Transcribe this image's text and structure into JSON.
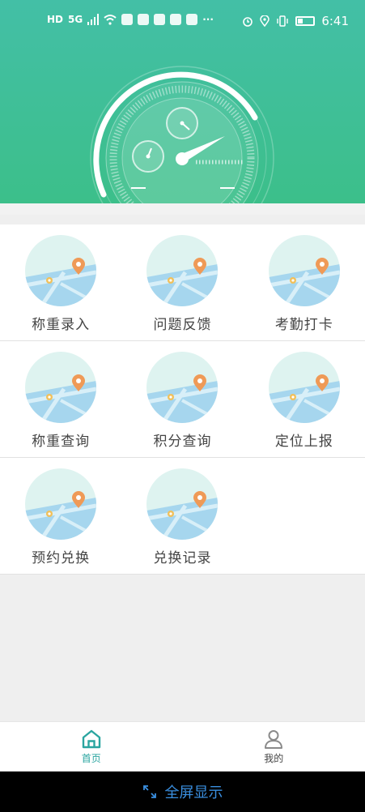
{
  "status_bar": {
    "left_text": [
      "HD",
      "5G"
    ],
    "more": "···",
    "time": "6:41"
  },
  "menu": {
    "rows": [
      [
        {
          "label": "称重录入"
        },
        {
          "label": "问题反馈"
        },
        {
          "label": "考勤打卡"
        }
      ],
      [
        {
          "label": "称重查询"
        },
        {
          "label": "积分查询"
        },
        {
          "label": "定位上报"
        }
      ],
      [
        {
          "label": "预约兑换"
        },
        {
          "label": "兑换记录"
        }
      ]
    ]
  },
  "tabs": [
    {
      "label": "首页",
      "icon": "home-icon",
      "active": true
    },
    {
      "label": "我的",
      "icon": "user-icon",
      "active": false
    }
  ],
  "fullscreen": {
    "label": "全屏显示",
    "icon": "expand-icon"
  },
  "colors": {
    "header_top": "#43bfa6",
    "header_bottom": "#3cbf8a",
    "accent": "#2aa5a0",
    "fullscreen": "#3a8fe0"
  }
}
